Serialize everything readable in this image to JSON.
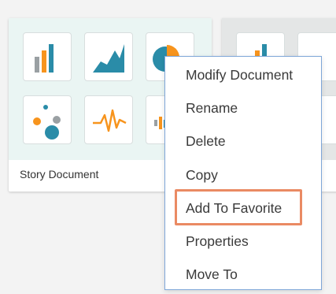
{
  "card": {
    "title": "Story Document"
  },
  "tiles": [
    {
      "icon": "bar-chart-icon"
    },
    {
      "icon": "area-chart-icon"
    },
    {
      "icon": "pie-chart-icon"
    },
    {
      "icon": "bubble-chart-icon"
    },
    {
      "icon": "line-chart-icon"
    },
    {
      "icon": "column-chart-icon"
    }
  ],
  "context_menu": {
    "items": [
      {
        "label": "Modify Document"
      },
      {
        "label": "Rename"
      },
      {
        "label": "Delete"
      },
      {
        "label": "Copy"
      },
      {
        "label": "Add To Favorite"
      },
      {
        "label": "Properties"
      },
      {
        "label": "Move To"
      }
    ],
    "highlighted_item": "Add To Favorite"
  },
  "colors": {
    "accent_teal": "#2a8ca8",
    "accent_orange": "#f7941d",
    "accent_gray": "#9aa0a3",
    "highlight_border": "#ea8a63",
    "menu_border": "#7ea6d8"
  }
}
